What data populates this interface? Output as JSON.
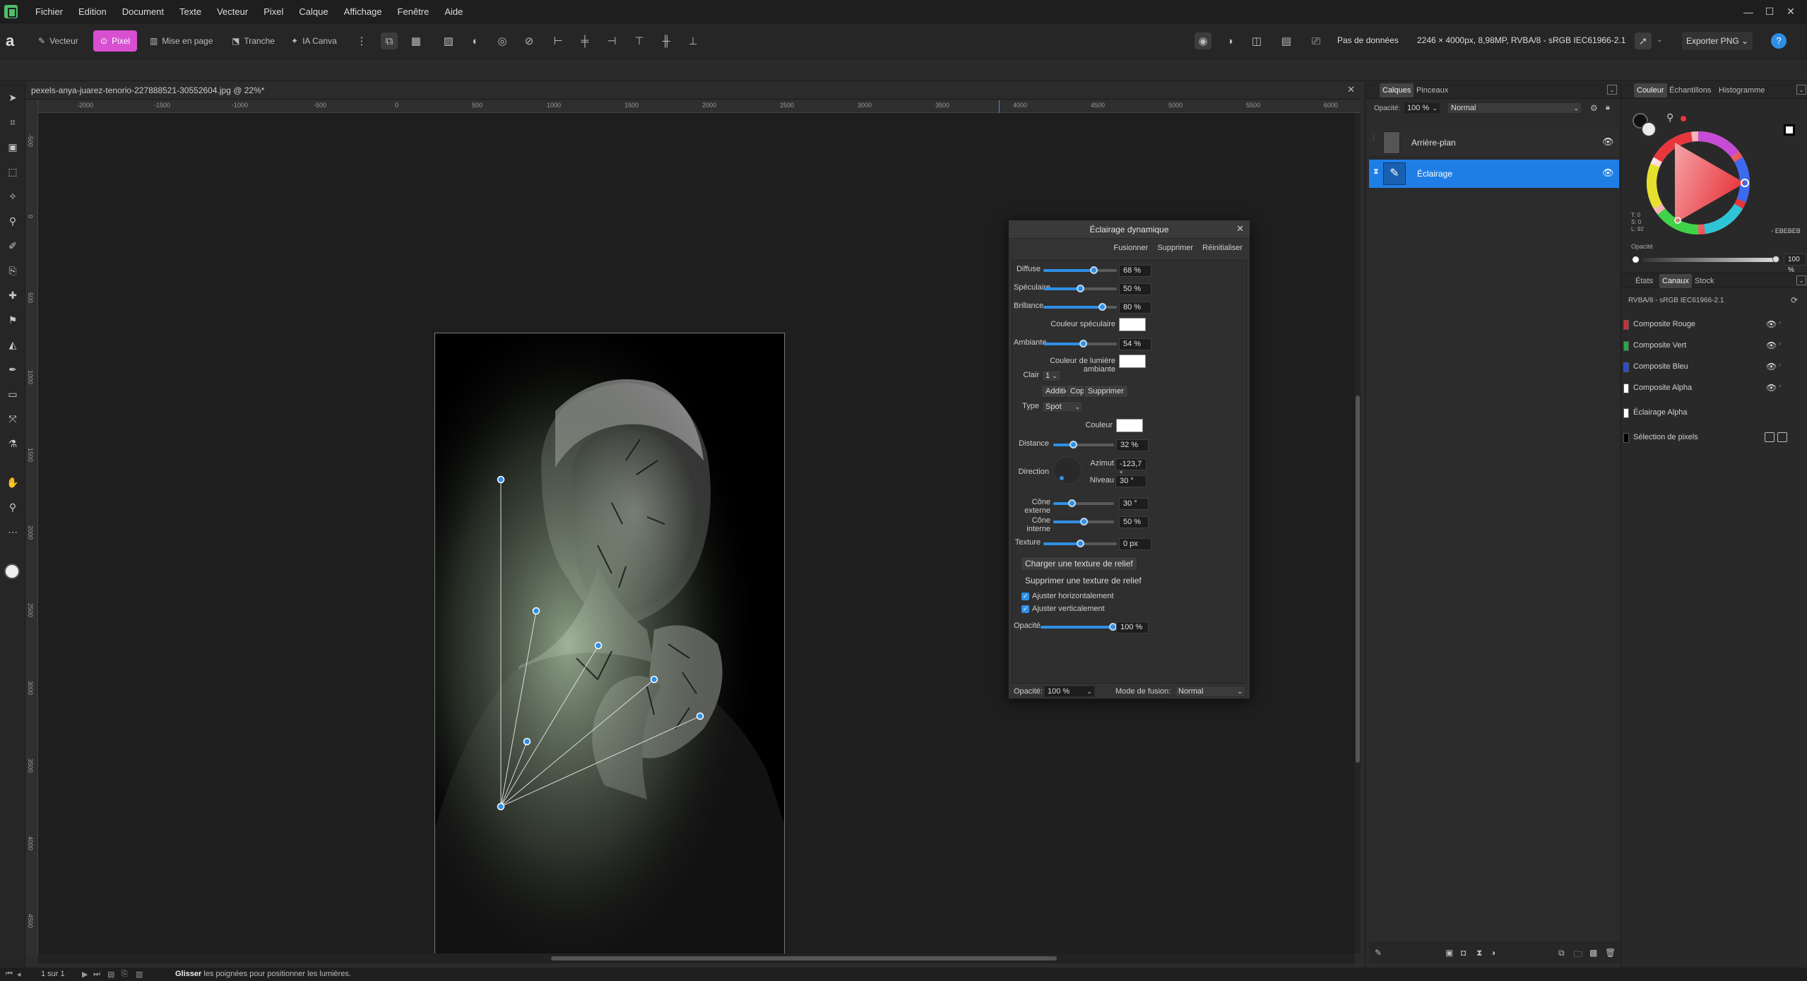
{
  "menu": [
    "Fichier",
    "Edition",
    "Document",
    "Texte",
    "Vecteur",
    "Pixel",
    "Calque",
    "Affichage",
    "Fenêtre",
    "Aide"
  ],
  "personas": [
    {
      "label": "Vecteur",
      "icon": "vector-persona-icon"
    },
    {
      "label": "Pixel",
      "icon": "pixel-persona-icon"
    },
    {
      "label": "Mise en page",
      "icon": "layout-persona-icon"
    },
    {
      "label": "Tranche",
      "icon": "slice-persona-icon"
    },
    {
      "label": "IA Canva",
      "icon": "ai-canva-persona-icon"
    }
  ],
  "toolbar": {
    "no_data": "Pas de données",
    "doc_info": "2246 × 4000px, 8,98MP, RVBA/8 - sRGB IEC61966-2.1",
    "export": "Exporter PNG"
  },
  "document": {
    "tab_title": "pexels-anya-juarez-tenorio-227888521-30552604.jpg @ 22%*"
  },
  "ruler": {
    "h_labels": [
      "-2000",
      "-1500",
      "-1000",
      "-500",
      "0",
      "500",
      "1000",
      "1500",
      "2000",
      "2500",
      "3000",
      "3500",
      "4000",
      "4500",
      "5000",
      "5500",
      "6000"
    ],
    "v_labels": [
      "-500",
      "0",
      "500",
      "1000",
      "1500",
      "2000",
      "2500",
      "3000",
      "3500",
      "4000",
      "4500"
    ]
  },
  "dialog": {
    "title": "Éclairage dynamique",
    "actions": [
      "Fusionner",
      "Supprimer",
      "Réinitialiser"
    ],
    "sliders": {
      "diffuse": {
        "label": "Diffuse",
        "value": "68 %",
        "level": 0.68
      },
      "speculaire": {
        "label": "Spéculaire",
        "value": "50 %",
        "level": 0.5
      },
      "brillance": {
        "label": "Brillance",
        "value": "80 %",
        "level": 0.8
      },
      "ambiante": {
        "label": "Ambiante",
        "value": "54 %",
        "level": 0.54
      },
      "distance": {
        "label": "Distance",
        "value": "32 %",
        "level": 0.32
      },
      "cone_externe": {
        "label": "Cône externe",
        "value": "30 °",
        "level": 0.3
      },
      "cone_interne": {
        "label": "Cône interne",
        "value": "50 %",
        "level": 0.5
      },
      "texture": {
        "label": "Texture",
        "value": "0 px",
        "level": 0.5
      },
      "opacite": {
        "label": "Opacité",
        "value": "100 %",
        "level": 1.0
      }
    },
    "couleur_speculaire": "Couleur spéculaire",
    "couleur_ambiante": "Couleur de lumière ambiante",
    "clair_label": "Clair",
    "clair_value": "1",
    "light_buttons": [
      "Addition",
      "Copier",
      "Supprimer"
    ],
    "type_label": "Type",
    "type_value": "Spot",
    "couleur_label": "Couleur",
    "direction_label": "Direction",
    "azimut_label": "Azimut",
    "azimut_value": "-123,7 °",
    "niveau_label": "Niveau",
    "niveau_value": "30 °",
    "load_texture": "Charger une texture de relief",
    "remove_texture": "Supprimer une texture de relief",
    "adjust_h": "Ajuster horizontalement",
    "adjust_v": "Ajuster verticalement",
    "footer_opacity_label": "Opacité:",
    "footer_opacity_value": "100 %",
    "footer_blend_label": "Mode de fusion:",
    "footer_blend_value": "Normal"
  },
  "layers_panel": {
    "tabs": [
      "Calques",
      "Pinceaux"
    ],
    "opacity_label": "Opacité:",
    "opacity_value": "100 %",
    "blend": "Normal",
    "layers": [
      {
        "name": "Arrière-plan",
        "selected": false
      },
      {
        "name": "Éclairage",
        "selected": true
      }
    ]
  },
  "color_panel": {
    "tabs": [
      "Couleur",
      "Échantillons",
      "Histogramme"
    ],
    "hex": "EBEBEB",
    "tsl": [
      "T: 0",
      "S: 0",
      "L: 92"
    ],
    "opacity_label": "Opacité",
    "opacity_value": "100 %",
    "accent": "#e8363d"
  },
  "channels_panel": {
    "tabs": [
      "États",
      "Canaux",
      "Stock"
    ],
    "profile": "RVBA/8 - sRGB IEC61966-2.1",
    "channels": [
      {
        "name": "Composite Rouge",
        "color": "#c8313c"
      },
      {
        "name": "Composite Vert",
        "color": "#25a84a"
      },
      {
        "name": "Composite Bleu",
        "color": "#2a4bd6"
      },
      {
        "name": "Composite Alpha",
        "color": "#ffffff"
      },
      {
        "name": "Éclairage Alpha",
        "color": "#ffffff"
      },
      {
        "name": "Sélection de pixels",
        "color": "#000000"
      }
    ]
  },
  "status": {
    "page": "1 sur 1",
    "hint_bold": "Glisser",
    "hint": "les poignées pour positionner les lumières."
  },
  "colors": {
    "accent_blue": "#2f8fe6",
    "pixel_persona": "#d84fd2",
    "selected_layer": "#1f7ee6"
  }
}
